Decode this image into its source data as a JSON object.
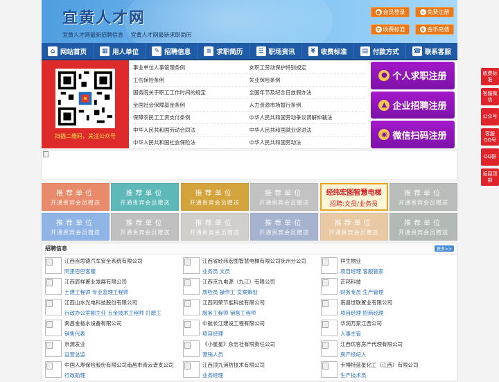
{
  "header": {
    "logo": "宜黄人才网",
    "subtitle_1": "宜黄人才网最新招聘信息",
    "subtitle_2": "宜黄人才网最新求职简历",
    "buttons": [
      {
        "label": "会员登录",
        "icon": "user-icon"
      },
      {
        "label": "免费注册",
        "icon": "register-icon"
      },
      {
        "label": "收费标准",
        "icon": "price-icon"
      },
      {
        "label": "金币充值",
        "icon": "coin-icon"
      }
    ]
  },
  "nav": [
    {
      "label": "网站首页",
      "icon": "home-icon"
    },
    {
      "label": "用人单位",
      "icon": "building-icon"
    },
    {
      "label": "招聘信息",
      "icon": "recruit-icon"
    },
    {
      "label": "求职简历",
      "icon": "resume-icon"
    },
    {
      "label": "职场资讯",
      "icon": "news-icon"
    },
    {
      "label": "收费标准",
      "icon": "price-icon"
    },
    {
      "label": "付款方式",
      "icon": "payment-icon"
    },
    {
      "label": "联系客服",
      "icon": "phone-icon"
    }
  ],
  "qr": {
    "caption": "扫描二维码，关注公众号"
  },
  "laws": [
    "事业单位人事管理条例",
    "女职工劳动保护特别规定",
    "工伤保险条例",
    "失业保险条例",
    "国务院关于职工工作时间的规定",
    "全国年节及纪念日放假办法",
    "全国社会保障基金条例",
    "人力资源市场暂行条例",
    "保障农民工工资支付条例",
    "中华人民共和国劳动争议调解仲裁法",
    "中华人民共和国劳动合同法",
    "中华人民共和国就业促进法",
    "中华人民共和国社会保险法",
    "中华人民共和国劳动法"
  ],
  "register": [
    {
      "label": "个人求职注册",
      "icon": "person-icon"
    },
    {
      "label": "企业招聘注册",
      "icon": "company-icon"
    },
    {
      "label": "微信扫码注册",
      "icon": "wechat-icon"
    }
  ],
  "recs": {
    "title": "推荐单位",
    "sub": "开通贵宾会员赠送",
    "colors": [
      "#e88b6a",
      "#5fb8b8",
      "#d3a43c",
      "#c2c2c2",
      "#ad9ee0",
      "#9bc478",
      "#8fb4e6",
      "#c0c0c0",
      "#c4c4c4",
      "#a6b3cf",
      "#e8c9a4",
      "#b3bab6"
    ],
    "ad": {
      "line1": "经纬宏图智慧电梯",
      "line2": "招聘:文员/业务员"
    }
  },
  "jobs": {
    "title": "招聘信息",
    "more": "更多>>",
    "items": [
      {
        "company": "江西百思德汽车安全系统有限公司",
        "positions": "阿里巴巴客服"
      },
      {
        "company": "江西省经纬宏图智慧电梯有限公司抚州分公司",
        "positions": "业务员 文员"
      },
      {
        "company": "祥生物业",
        "positions": "项目经理 客服管家"
      },
      {
        "company": "江西辰祥置业发展有限公司",
        "positions": "土建工程师 专业监理工程师"
      },
      {
        "company": "江西京九电源（九江）有限公司",
        "positions": "质检员 操作工 文案策划"
      },
      {
        "company": "正邦科技",
        "positions": "财务专员 生产管理"
      },
      {
        "company": "江西山水光电科技股份有限公司",
        "positions": "行政办公室副主任 五金技术工程师 打磨工"
      },
      {
        "company": "江西同荣节能科技有限公司",
        "positions": "服务工程师 销售工程师"
      },
      {
        "company": "南昌世联置业有限公司",
        "positions": "项目经理 招商经理"
      },
      {
        "company": "南昌金格水设备有限公司",
        "positions": "销售代表"
      },
      {
        "company": "中航长江建设工程有限公司",
        "positions": "项目经理"
      },
      {
        "company": "华润万家江西公司",
        "positions": "人事主管"
      },
      {
        "company": "京源发业",
        "positions": "运营总监"
      },
      {
        "company": "《小星星》杂志社有限责任公司",
        "positions": "营销人员"
      },
      {
        "company": "江西优客房产代理有限公司",
        "positions": "房产经纪人"
      },
      {
        "company": "中国人寿保险股份有限公司南昌市青云谱支公司",
        "positions": "行政助理"
      },
      {
        "company": "江西顶九消防技术有限公司",
        "positions": "业务经理"
      },
      {
        "company": "卡博特蓝星化工（江西）有限公司",
        "positions": "生产技术员"
      }
    ]
  },
  "side": [
    "收费标准",
    "客服微信",
    "公众号",
    "客服QQ号",
    "QQ群",
    "返回顶部"
  ]
}
